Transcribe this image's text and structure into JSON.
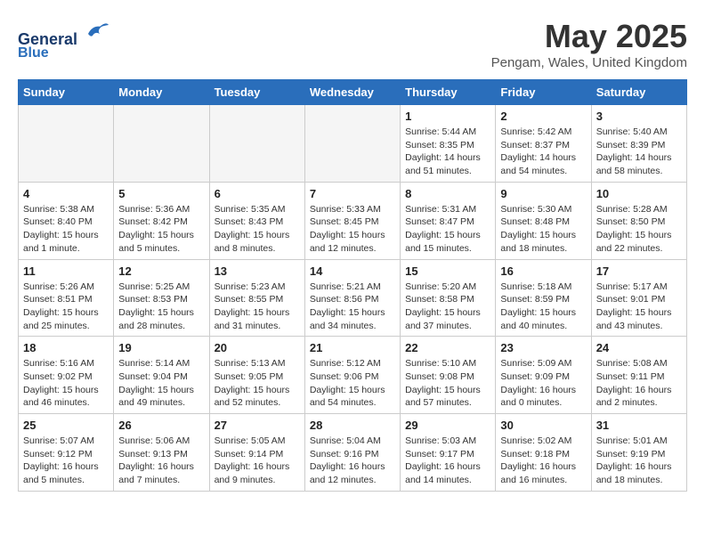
{
  "logo": {
    "line1": "General",
    "line2": "Blue"
  },
  "title": "May 2025",
  "location": "Pengam, Wales, United Kingdom",
  "weekdays": [
    "Sunday",
    "Monday",
    "Tuesday",
    "Wednesday",
    "Thursday",
    "Friday",
    "Saturday"
  ],
  "weeks": [
    [
      {
        "day": "",
        "info": ""
      },
      {
        "day": "",
        "info": ""
      },
      {
        "day": "",
        "info": ""
      },
      {
        "day": "",
        "info": ""
      },
      {
        "day": "1",
        "info": "Sunrise: 5:44 AM\nSunset: 8:35 PM\nDaylight: 14 hours\nand 51 minutes."
      },
      {
        "day": "2",
        "info": "Sunrise: 5:42 AM\nSunset: 8:37 PM\nDaylight: 14 hours\nand 54 minutes."
      },
      {
        "day": "3",
        "info": "Sunrise: 5:40 AM\nSunset: 8:39 PM\nDaylight: 14 hours\nand 58 minutes."
      }
    ],
    [
      {
        "day": "4",
        "info": "Sunrise: 5:38 AM\nSunset: 8:40 PM\nDaylight: 15 hours\nand 1 minute."
      },
      {
        "day": "5",
        "info": "Sunrise: 5:36 AM\nSunset: 8:42 PM\nDaylight: 15 hours\nand 5 minutes."
      },
      {
        "day": "6",
        "info": "Sunrise: 5:35 AM\nSunset: 8:43 PM\nDaylight: 15 hours\nand 8 minutes."
      },
      {
        "day": "7",
        "info": "Sunrise: 5:33 AM\nSunset: 8:45 PM\nDaylight: 15 hours\nand 12 minutes."
      },
      {
        "day": "8",
        "info": "Sunrise: 5:31 AM\nSunset: 8:47 PM\nDaylight: 15 hours\nand 15 minutes."
      },
      {
        "day": "9",
        "info": "Sunrise: 5:30 AM\nSunset: 8:48 PM\nDaylight: 15 hours\nand 18 minutes."
      },
      {
        "day": "10",
        "info": "Sunrise: 5:28 AM\nSunset: 8:50 PM\nDaylight: 15 hours\nand 22 minutes."
      }
    ],
    [
      {
        "day": "11",
        "info": "Sunrise: 5:26 AM\nSunset: 8:51 PM\nDaylight: 15 hours\nand 25 minutes."
      },
      {
        "day": "12",
        "info": "Sunrise: 5:25 AM\nSunset: 8:53 PM\nDaylight: 15 hours\nand 28 minutes."
      },
      {
        "day": "13",
        "info": "Sunrise: 5:23 AM\nSunset: 8:55 PM\nDaylight: 15 hours\nand 31 minutes."
      },
      {
        "day": "14",
        "info": "Sunrise: 5:21 AM\nSunset: 8:56 PM\nDaylight: 15 hours\nand 34 minutes."
      },
      {
        "day": "15",
        "info": "Sunrise: 5:20 AM\nSunset: 8:58 PM\nDaylight: 15 hours\nand 37 minutes."
      },
      {
        "day": "16",
        "info": "Sunrise: 5:18 AM\nSunset: 8:59 PM\nDaylight: 15 hours\nand 40 minutes."
      },
      {
        "day": "17",
        "info": "Sunrise: 5:17 AM\nSunset: 9:01 PM\nDaylight: 15 hours\nand 43 minutes."
      }
    ],
    [
      {
        "day": "18",
        "info": "Sunrise: 5:16 AM\nSunset: 9:02 PM\nDaylight: 15 hours\nand 46 minutes."
      },
      {
        "day": "19",
        "info": "Sunrise: 5:14 AM\nSunset: 9:04 PM\nDaylight: 15 hours\nand 49 minutes."
      },
      {
        "day": "20",
        "info": "Sunrise: 5:13 AM\nSunset: 9:05 PM\nDaylight: 15 hours\nand 52 minutes."
      },
      {
        "day": "21",
        "info": "Sunrise: 5:12 AM\nSunset: 9:06 PM\nDaylight: 15 hours\nand 54 minutes."
      },
      {
        "day": "22",
        "info": "Sunrise: 5:10 AM\nSunset: 9:08 PM\nDaylight: 15 hours\nand 57 minutes."
      },
      {
        "day": "23",
        "info": "Sunrise: 5:09 AM\nSunset: 9:09 PM\nDaylight: 16 hours\nand 0 minutes."
      },
      {
        "day": "24",
        "info": "Sunrise: 5:08 AM\nSunset: 9:11 PM\nDaylight: 16 hours\nand 2 minutes."
      }
    ],
    [
      {
        "day": "25",
        "info": "Sunrise: 5:07 AM\nSunset: 9:12 PM\nDaylight: 16 hours\nand 5 minutes."
      },
      {
        "day": "26",
        "info": "Sunrise: 5:06 AM\nSunset: 9:13 PM\nDaylight: 16 hours\nand 7 minutes."
      },
      {
        "day": "27",
        "info": "Sunrise: 5:05 AM\nSunset: 9:14 PM\nDaylight: 16 hours\nand 9 minutes."
      },
      {
        "day": "28",
        "info": "Sunrise: 5:04 AM\nSunset: 9:16 PM\nDaylight: 16 hours\nand 12 minutes."
      },
      {
        "day": "29",
        "info": "Sunrise: 5:03 AM\nSunset: 9:17 PM\nDaylight: 16 hours\nand 14 minutes."
      },
      {
        "day": "30",
        "info": "Sunrise: 5:02 AM\nSunset: 9:18 PM\nDaylight: 16 hours\nand 16 minutes."
      },
      {
        "day": "31",
        "info": "Sunrise: 5:01 AM\nSunset: 9:19 PM\nDaylight: 16 hours\nand 18 minutes."
      }
    ]
  ]
}
